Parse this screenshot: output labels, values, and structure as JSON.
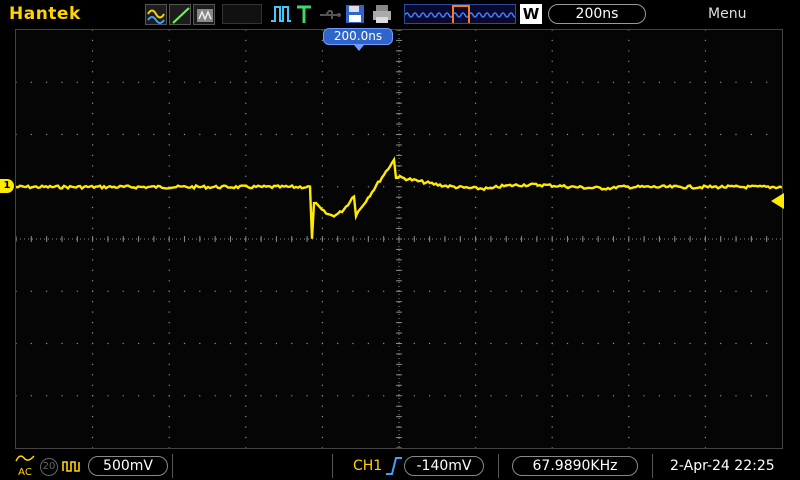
{
  "brand": "Hantek",
  "toolbar": {
    "timebase": "200ns",
    "w_label": "W",
    "menu_label": "Menu",
    "acq_icons": [
      "sine-wave-icon",
      "pulse-wave-icon",
      "ramp-icon"
    ],
    "status_icons": [
      "run-stop-icon",
      "trigger-t-icon",
      "usb-icon",
      "save-disk-icon",
      "print-icon"
    ]
  },
  "screen": {
    "trigger_time_marker": "200.0ns",
    "channel_marker": "1",
    "trace_color": "#ffea00",
    "grid_color": "#8a8a8a"
  },
  "bottom": {
    "coupling_label": "AC",
    "bandwidth_label": "20",
    "volts_per_div": "500mV",
    "trigger_channel": "CH1",
    "trigger_level": "-140mV",
    "frequency": "67.9890KHz",
    "datetime": "2-Apr-24 22:25"
  },
  "colors": {
    "accent": "#ffd200",
    "trace": "#ffea00",
    "marker_blue": "#2f64c9"
  }
}
